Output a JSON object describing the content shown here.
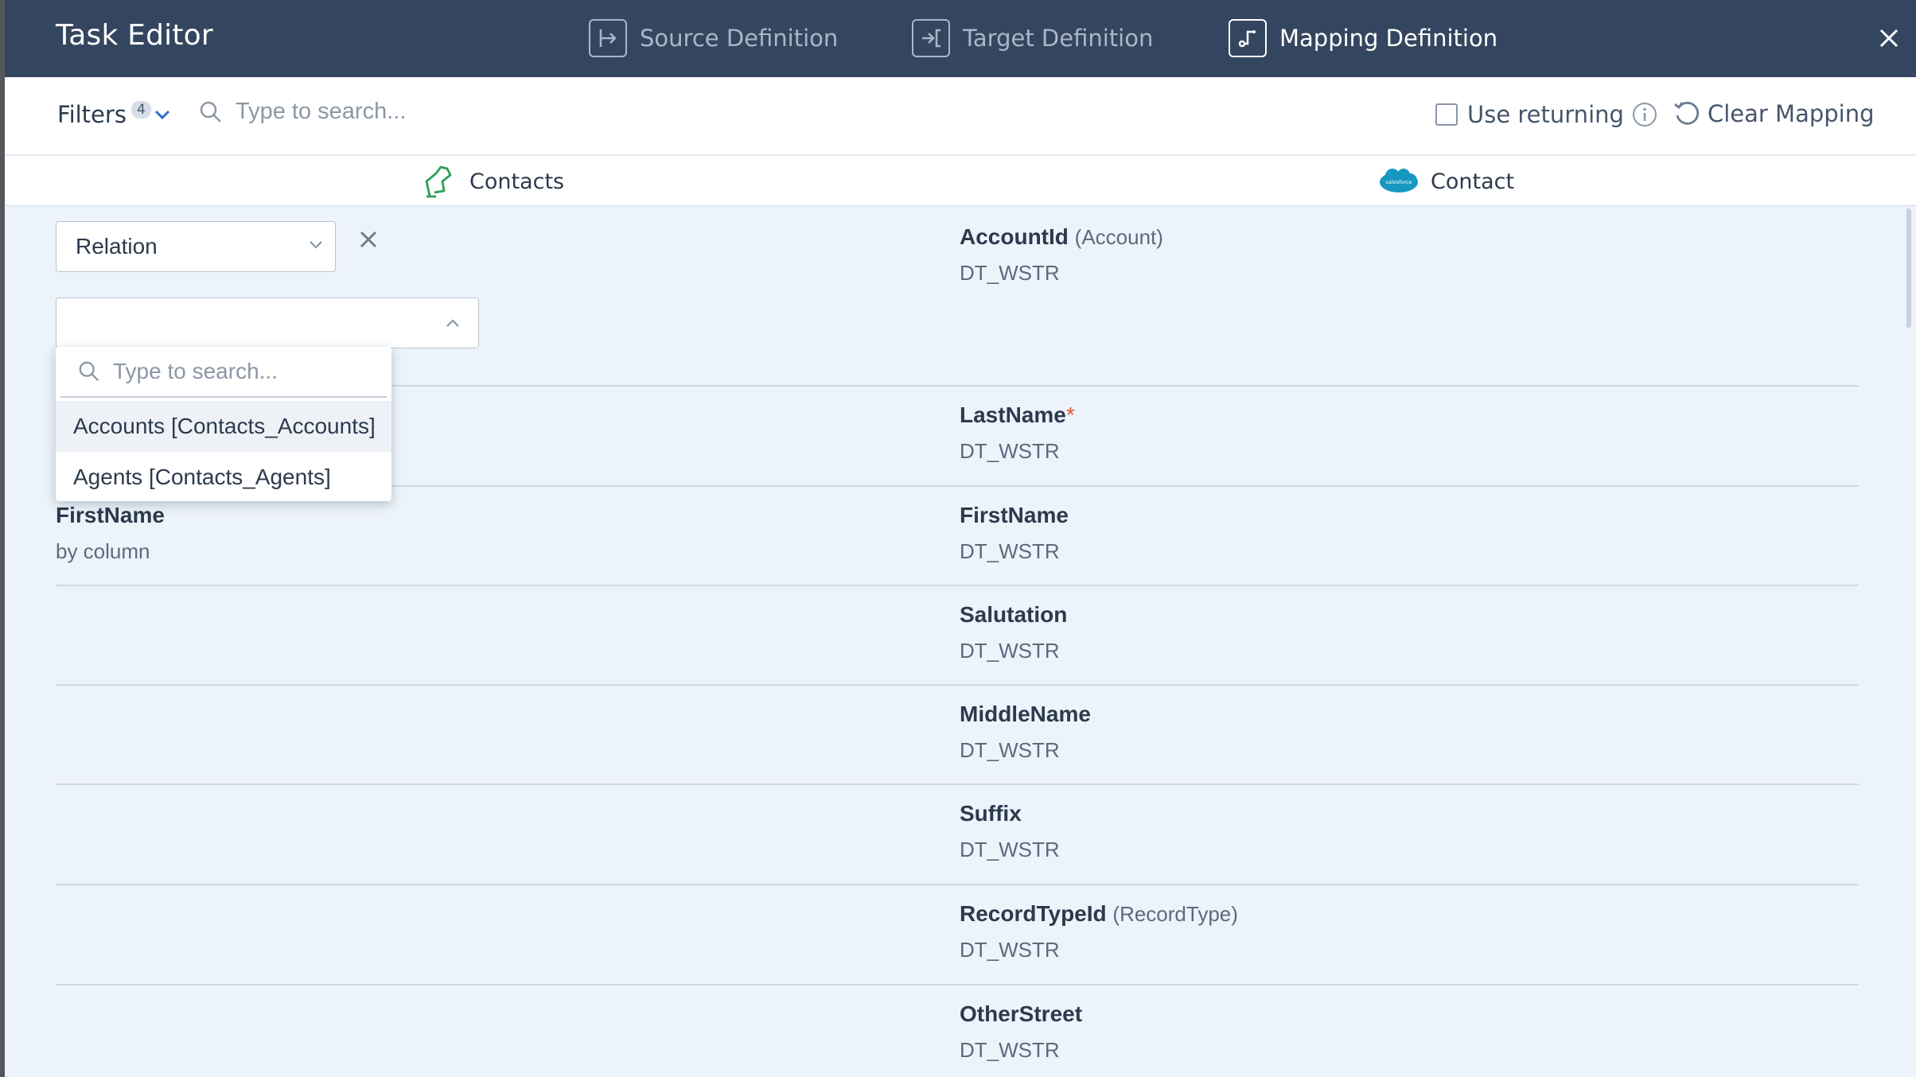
{
  "header": {
    "title": "Task Editor",
    "tabs": [
      {
        "label": "Source Definition",
        "icon": "source-definition-icon",
        "active": false
      },
      {
        "label": "Target Definition",
        "icon": "target-definition-icon",
        "active": false
      },
      {
        "label": "Mapping Definition",
        "icon": "mapping-definition-icon",
        "active": true
      }
    ]
  },
  "toolbar": {
    "filters_label": "Filters",
    "filters_count": "4",
    "search_placeholder": "Type to search...",
    "use_returning_label": "Use returning",
    "use_returning_checked": false,
    "clear_mapping_label": "Clear Mapping"
  },
  "columns": {
    "source": "Contacts",
    "target": "Contact"
  },
  "relation_select": {
    "value": "Relation"
  },
  "dropdown": {
    "search_placeholder": "Type to search...",
    "options": [
      "Accounts [Contacts_Accounts]",
      "Agents [Contacts_Agents]"
    ]
  },
  "rows": [
    {
      "target_name": "AccountId",
      "target_ref": "(Account)",
      "target_type": "DT_WSTR"
    },
    {
      "target_name": "LastName",
      "required": "*",
      "target_type": "DT_WSTR"
    },
    {
      "source_name": "FirstName",
      "source_mode": "by column",
      "target_name": "FirstName",
      "target_type": "DT_WSTR"
    },
    {
      "target_name": "Salutation",
      "target_type": "DT_WSTR"
    },
    {
      "target_name": "MiddleName",
      "target_type": "DT_WSTR"
    },
    {
      "target_name": "Suffix",
      "target_type": "DT_WSTR"
    },
    {
      "target_name": "RecordTypeId",
      "target_ref": "(RecordType)",
      "target_type": "DT_WSTR"
    },
    {
      "target_name": "OtherStreet",
      "target_type": "DT_WSTR"
    }
  ],
  "colors": {
    "header_bg": "#34465f",
    "body_bg": "#edf3fa",
    "required": "#e2552b",
    "salesforce": "#1798c1",
    "contacts_icon": "#2f9e57"
  }
}
